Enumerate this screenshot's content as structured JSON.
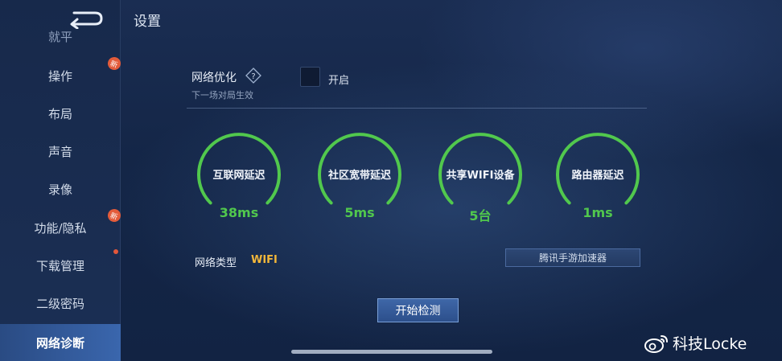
{
  "app": {
    "title": "设置"
  },
  "sidebar": {
    "partial_top_label": "就平",
    "items": [
      {
        "label": "操作",
        "badge": "新"
      },
      {
        "label": "布局"
      },
      {
        "label": "声音"
      },
      {
        "label": "录像"
      },
      {
        "label": "功能/隐私",
        "badge": "新"
      },
      {
        "label": "下载管理",
        "dot": true
      },
      {
        "label": "二级密码"
      },
      {
        "label": "网络诊断",
        "active": true
      }
    ]
  },
  "optimization": {
    "title": "网络优化",
    "subtitle": "下一场对局生效",
    "checkbox_label": "开启",
    "checked": false
  },
  "gauges": [
    {
      "label": "互联网延迟",
      "value": "38ms"
    },
    {
      "label": "社区宽带延迟",
      "value": "5ms"
    },
    {
      "label": "共享WIFI设备",
      "value": "5台"
    },
    {
      "label": "路由器延迟",
      "value": "1ms"
    }
  ],
  "network": {
    "type_label": "网络类型",
    "type_value": "WIFI",
    "accelerator_button": "腾讯手游加速器"
  },
  "actions": {
    "start_button": "开始检测"
  },
  "watermark": {
    "text": "科技Locke"
  },
  "colors": {
    "accent_green": "#51c84d",
    "wifi_yellow": "#f3b73a",
    "active_tab": "#3a66ad"
  }
}
